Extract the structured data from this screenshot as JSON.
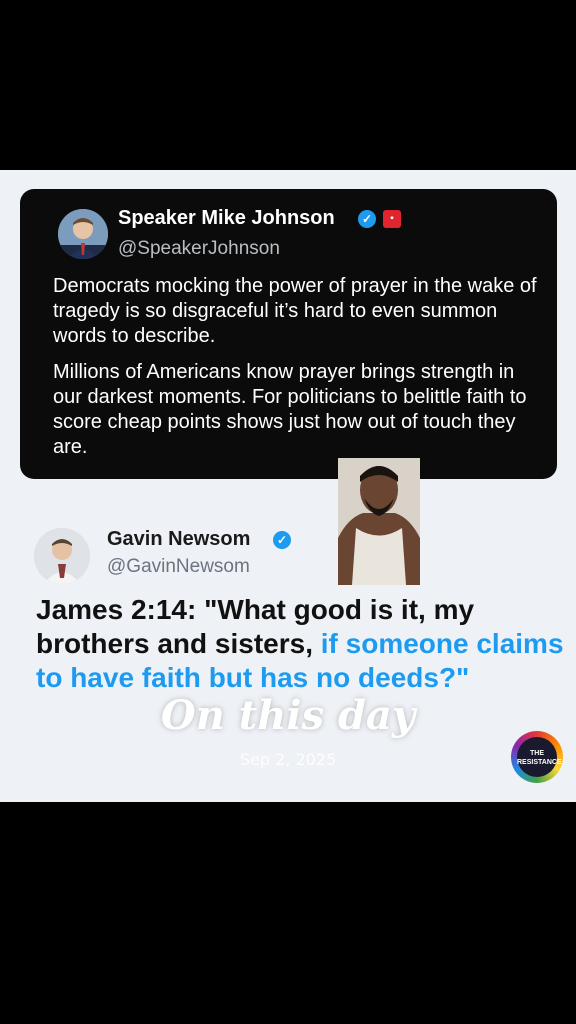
{
  "tweet1": {
    "name": "Speaker Mike Johnson",
    "handle": "@SpeakerJohnson",
    "paragraph1": "Democrats mocking the power of prayer in the wake of tragedy is so disgraceful it’s hard to even summon words to describe.",
    "paragraph2": "Millions of Americans know prayer brings strength in our darkest moments. For politicians to belittle faith to score cheap points shows just how out of touch they are."
  },
  "tweet2": {
    "name": "Gavin Newsom",
    "handle": "@GavinNewsom",
    "quote_black": "James 2:14: \"What good is it, my brothers and sisters, ",
    "quote_blue": "if someone claims to have faith but has no deeds?\""
  },
  "overlay": {
    "title": "On this day",
    "date": "Sep 2, 2025"
  },
  "logo": {
    "text": "THE RESISTANCE"
  },
  "icons": {
    "verified": "verified-check-icon",
    "flag": "us-flag-icon"
  },
  "colors": {
    "accent_blue": "#1d9bf0",
    "dark_card": "#0b0b0c",
    "panel_bg": "#eef1f5"
  }
}
